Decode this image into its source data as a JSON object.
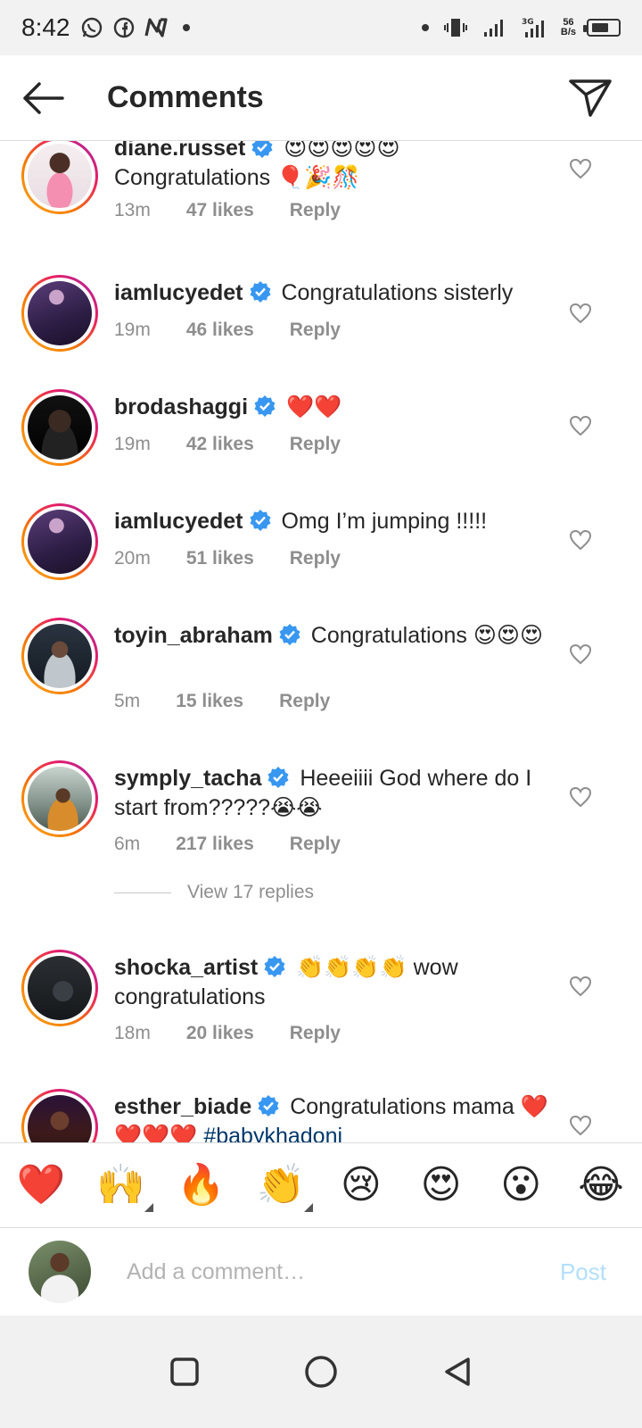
{
  "status_bar": {
    "time": "8:42",
    "net_speed_top": "56",
    "net_speed_bottom": "B/s",
    "network_type": "3G",
    "battery_level": 0.7
  },
  "header": {
    "title": "Comments"
  },
  "comments": [
    {
      "username": "diane.russet",
      "text": "😍😍😍😍😍\nCongratulations 🎈🎉🎊",
      "time": "13m",
      "likes": "47 likes",
      "reply": "Reply"
    },
    {
      "username": "iamlucyedet",
      "text": "Congratulations sisterly",
      "time": "19m",
      "likes": "46 likes",
      "reply": "Reply"
    },
    {
      "username": "brodashaggi",
      "text": "❤️❤️",
      "time": "19m",
      "likes": "42 likes",
      "reply": "Reply"
    },
    {
      "username": "iamlucyedet",
      "text": "Omg I’m jumping !!!!!",
      "time": "20m",
      "likes": "51 likes",
      "reply": "Reply"
    },
    {
      "username": "toyin_abraham",
      "text": "Congratulations 😍😍😍",
      "time": "5m",
      "likes": "15 likes",
      "reply": "Reply"
    },
    {
      "username": "symply_tacha",
      "text": "Heeeiiii God where do I start from?????😭😭",
      "time": "6m",
      "likes": "217 likes",
      "reply": "Reply"
    },
    {
      "username": "shocka_artist",
      "text": "👏👏👏👏 wow congratulations",
      "time": "18m",
      "likes": "20 likes",
      "reply": "Reply"
    },
    {
      "username": "esther_biade",
      "text": "Congratulations mama ❤️❤️❤️❤️",
      "hashtag": "#babykhadoni"
    }
  ],
  "view_replies": "View 17 replies",
  "emoji_bar": [
    "❤️",
    "🙌",
    "🔥",
    "👏",
    "😢",
    "😍",
    "😮",
    "😂"
  ],
  "add_comment": {
    "placeholder": "Add a comment…",
    "post_label": "Post"
  },
  "colors": {
    "accent_blue": "#0095f6",
    "verified_blue": "#3897f0",
    "post_disabled": "#b2dffc",
    "meta_gray": "#8e8e8e",
    "hashtag": "#00376b"
  }
}
